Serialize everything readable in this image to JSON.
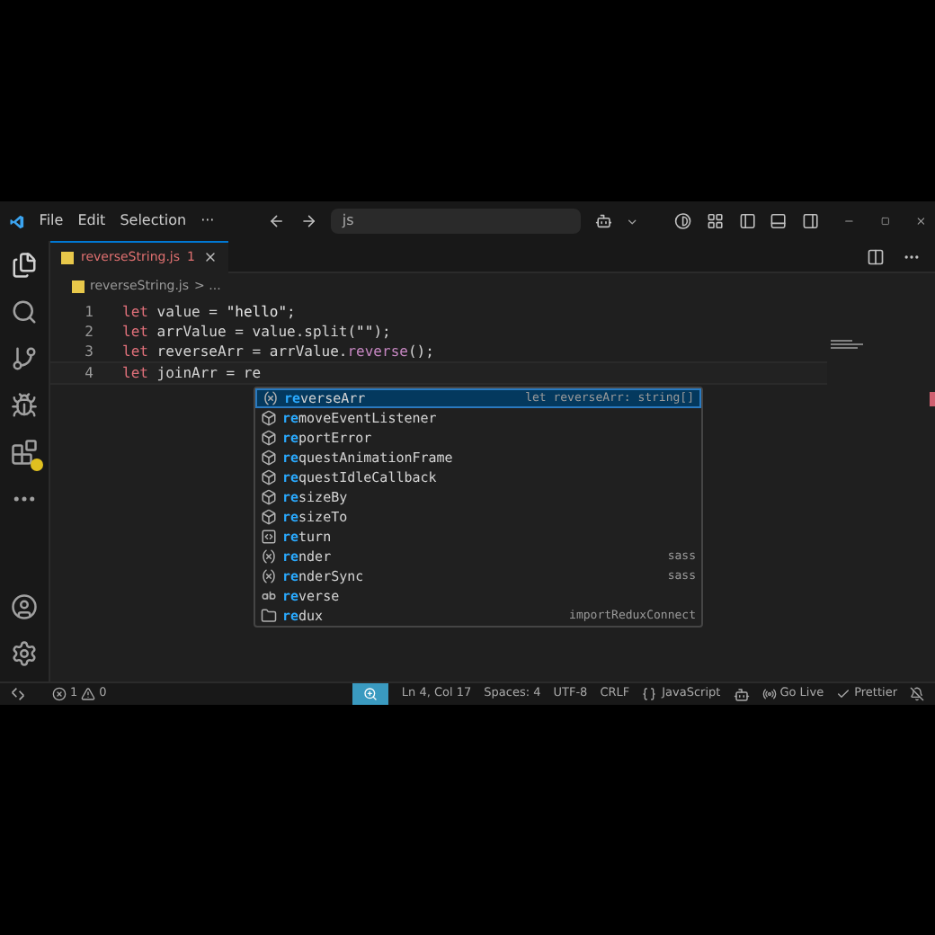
{
  "title_bar": {
    "menu": [
      "File",
      "Edit",
      "Selection",
      "···"
    ],
    "search": {
      "value": "js"
    }
  },
  "tabs": [
    {
      "label": "reverseString.js",
      "problems": "1",
      "selected": true
    }
  ],
  "breadcrumb": {
    "file": "reverseString.js",
    "rest": "> ..."
  },
  "lines": [
    {
      "number": "1",
      "tokens": [
        {
          "kind": "keyword",
          "text": "let"
        },
        {
          "kind": "plain",
          "text": " value = "
        },
        {
          "kind": "string",
          "text": "\"hello\""
        },
        {
          "kind": "plain",
          "text": ";"
        }
      ]
    },
    {
      "number": "2",
      "tokens": [
        {
          "kind": "keyword",
          "text": "let"
        },
        {
          "kind": "plain",
          "text": " arrValue = value.split("
        },
        {
          "kind": "string",
          "text": "\"\""
        },
        {
          "kind": "plain",
          "text": ");"
        }
      ]
    },
    {
      "number": "3",
      "tokens": [
        {
          "kind": "keyword",
          "text": "let"
        },
        {
          "kind": "plain",
          "text": " reverseArr = arrValue."
        },
        {
          "kind": "method",
          "text": "reverse"
        },
        {
          "kind": "plain",
          "text": "();"
        }
      ]
    },
    {
      "number": "4",
      "tokens": [
        {
          "kind": "keyword",
          "text": "let"
        },
        {
          "kind": "plain",
          "text": " joinArr = re"
        }
      ]
    }
  ],
  "suggestions": [
    {
      "kind": "variable",
      "match": "re",
      "rest": "verseArr",
      "detail": "let reverseArr: string[]",
      "selected": true
    },
    {
      "kind": "method",
      "match": "re",
      "rest": "moveEventListener",
      "selected": false
    },
    {
      "kind": "method",
      "match": "re",
      "rest": "portError",
      "selected": false
    },
    {
      "kind": "method",
      "match": "re",
      "rest": "questAnimationFrame",
      "selected": false
    },
    {
      "kind": "method",
      "match": "re",
      "rest": "questIdleCallback",
      "selected": false
    },
    {
      "kind": "method",
      "match": "re",
      "rest": "sizeBy",
      "selected": false
    },
    {
      "kind": "method",
      "match": "re",
      "rest": "sizeTo",
      "selected": false
    },
    {
      "kind": "keyword",
      "match": "re",
      "rest": "turn",
      "selected": false
    },
    {
      "kind": "variable",
      "match": "re",
      "rest": "nder",
      "detail": "sass",
      "selected": false
    },
    {
      "kind": "variable",
      "match": "re",
      "rest": "nderSync",
      "detail": "sass",
      "selected": false
    },
    {
      "kind": "text",
      "match": "re",
      "rest": "verse",
      "selected": false
    },
    {
      "kind": "module",
      "match": "re",
      "rest": "dux",
      "detail": "importReduxConnect",
      "selected": false
    }
  ],
  "status_bar": {
    "errors": "1",
    "warnings": "0",
    "items": [
      "Ln 4, Col 17",
      "Spaces: 4",
      "UTF-8",
      "CRLF"
    ],
    "language": "JavaScript",
    "go_live": "Go Live",
    "prettier": "Prettier"
  }
}
